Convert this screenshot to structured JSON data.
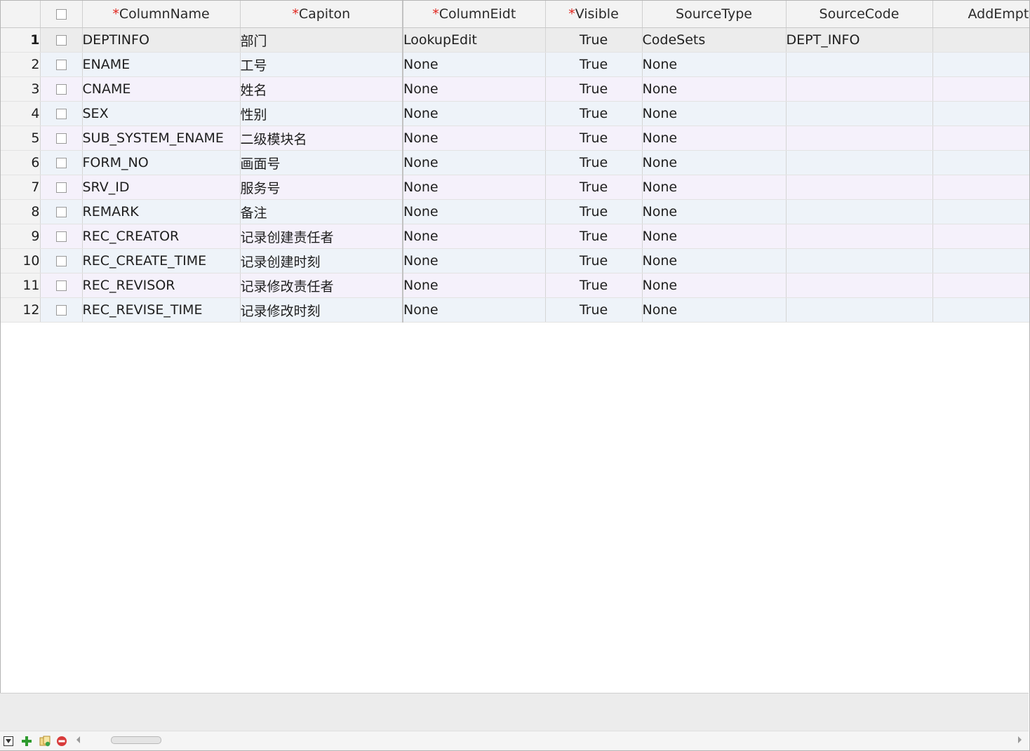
{
  "grid": {
    "columns": [
      {
        "label": "ColumnName",
        "required": "*"
      },
      {
        "label": "Capiton",
        "required": "*"
      },
      {
        "label": "ColumnEidt",
        "required": "*"
      },
      {
        "label": "Visible",
        "required": "*"
      },
      {
        "label": "SourceType",
        "required": ""
      },
      {
        "label": "SourceCode",
        "required": ""
      },
      {
        "label": "AddEmpty",
        "required": ""
      }
    ],
    "rows": [
      {
        "num": "1",
        "name": "DEPTINFO",
        "caption": "部门",
        "edit": "LookupEdit",
        "visible": "True",
        "source_type": "CodeSets",
        "source_code": "DEPT_INFO",
        "add_empty": "True"
      },
      {
        "num": "2",
        "name": "ENAME",
        "caption": "工号",
        "edit": "None",
        "visible": "True",
        "source_type": "None",
        "source_code": "",
        "add_empty": "True"
      },
      {
        "num": "3",
        "name": "CNAME",
        "caption": "姓名",
        "edit": "None",
        "visible": "True",
        "source_type": "None",
        "source_code": "",
        "add_empty": "True"
      },
      {
        "num": "4",
        "name": "SEX",
        "caption": "性别",
        "edit": "None",
        "visible": "True",
        "source_type": "None",
        "source_code": "",
        "add_empty": "True"
      },
      {
        "num": "5",
        "name": "SUB_SYSTEM_ENAME",
        "caption": "二级模块名",
        "edit": "None",
        "visible": "True",
        "source_type": "None",
        "source_code": "",
        "add_empty": "True"
      },
      {
        "num": "6",
        "name": "FORM_NO",
        "caption": "画面号",
        "edit": "None",
        "visible": "True",
        "source_type": "None",
        "source_code": "",
        "add_empty": "True"
      },
      {
        "num": "7",
        "name": "SRV_ID",
        "caption": "服务号",
        "edit": "None",
        "visible": "True",
        "source_type": "None",
        "source_code": "",
        "add_empty": "True"
      },
      {
        "num": "8",
        "name": "REMARK",
        "caption": "备注",
        "edit": "None",
        "visible": "True",
        "source_type": "None",
        "source_code": "",
        "add_empty": "True"
      },
      {
        "num": "9",
        "name": "REC_CREATOR",
        "caption": "记录创建责任者",
        "edit": "None",
        "visible": "True",
        "source_type": "None",
        "source_code": "",
        "add_empty": "True"
      },
      {
        "num": "10",
        "name": "REC_CREATE_TIME",
        "caption": "记录创建时刻",
        "edit": "None",
        "visible": "True",
        "source_type": "None",
        "source_code": "",
        "add_empty": "True"
      },
      {
        "num": "11",
        "name": "REC_REVISOR",
        "caption": "记录修改责任者",
        "edit": "None",
        "visible": "True",
        "source_type": "None",
        "source_code": "",
        "add_empty": "True"
      },
      {
        "num": "12",
        "name": "REC_REVISE_TIME",
        "caption": "记录修改时刻",
        "edit": "None",
        "visible": "True",
        "source_type": "None",
        "source_code": "",
        "add_empty": "True"
      }
    ]
  },
  "navigator": {
    "icons": [
      "filter-icon",
      "add-icon",
      "copy-icon",
      "delete-icon"
    ]
  },
  "colors": {
    "required_marker": "#e0241c",
    "add_icon": "#2e9a2e",
    "delete_icon": "#d83a3a"
  }
}
